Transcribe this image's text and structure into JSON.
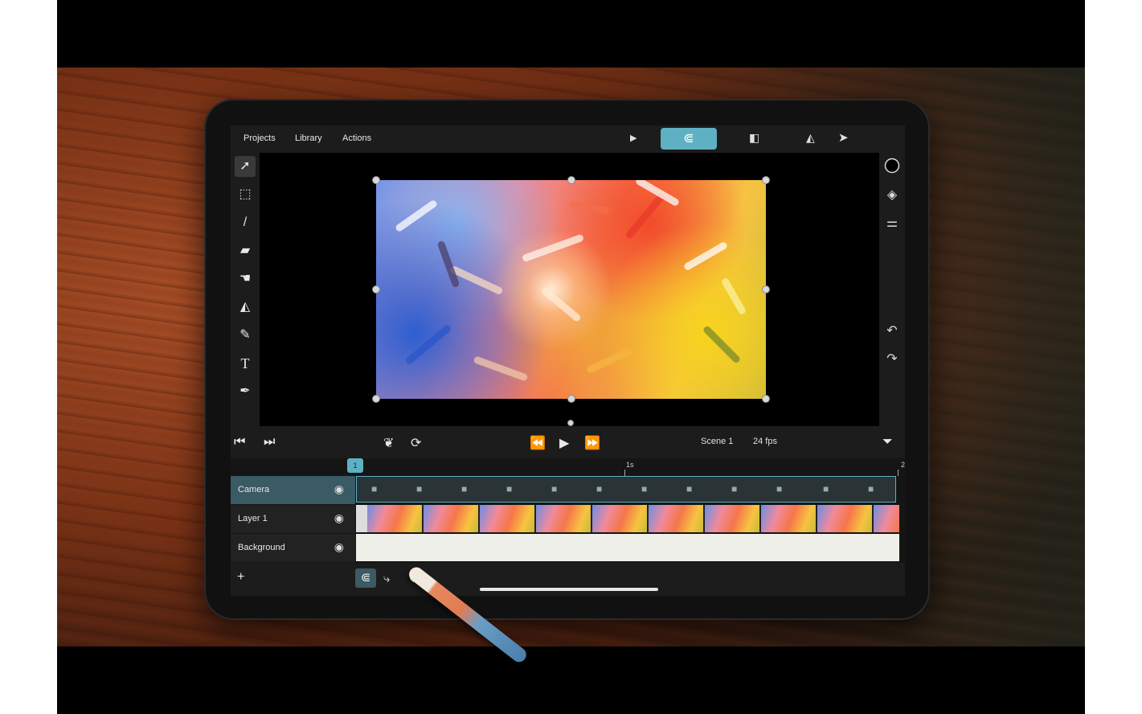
{
  "menu": {
    "projects": "Projects",
    "library": "Library",
    "actions": "Actions"
  },
  "toolbar": {
    "play_icon": "play-icon",
    "magnet_icon": "magnet-icon",
    "onion_icon": "onion-skin-icon",
    "flip_icon": "flip-icon",
    "share_icon": "send-icon"
  },
  "left_tools": [
    "select-arrow",
    "marquee",
    "brush",
    "eraser",
    "smudge",
    "fill",
    "eyedropper",
    "text",
    "pen"
  ],
  "right_tools": [
    "color-circle",
    "layers",
    "adjustments",
    "undo",
    "redo"
  ],
  "playback": {
    "scene": "Scene 1",
    "fps": "24 fps"
  },
  "timeline": {
    "playhead_frame": "1",
    "ruler_labels": [
      "1s",
      "2"
    ],
    "tracks": [
      {
        "name": "Camera",
        "selected": true
      },
      {
        "name": "Layer 1",
        "selected": false
      },
      {
        "name": "Background",
        "selected": false
      }
    ]
  },
  "bottom": {
    "add_label": "+"
  },
  "colors": {
    "accent": "#5fb0c2",
    "panel": "#1c1c1c",
    "stage": "#000000"
  }
}
